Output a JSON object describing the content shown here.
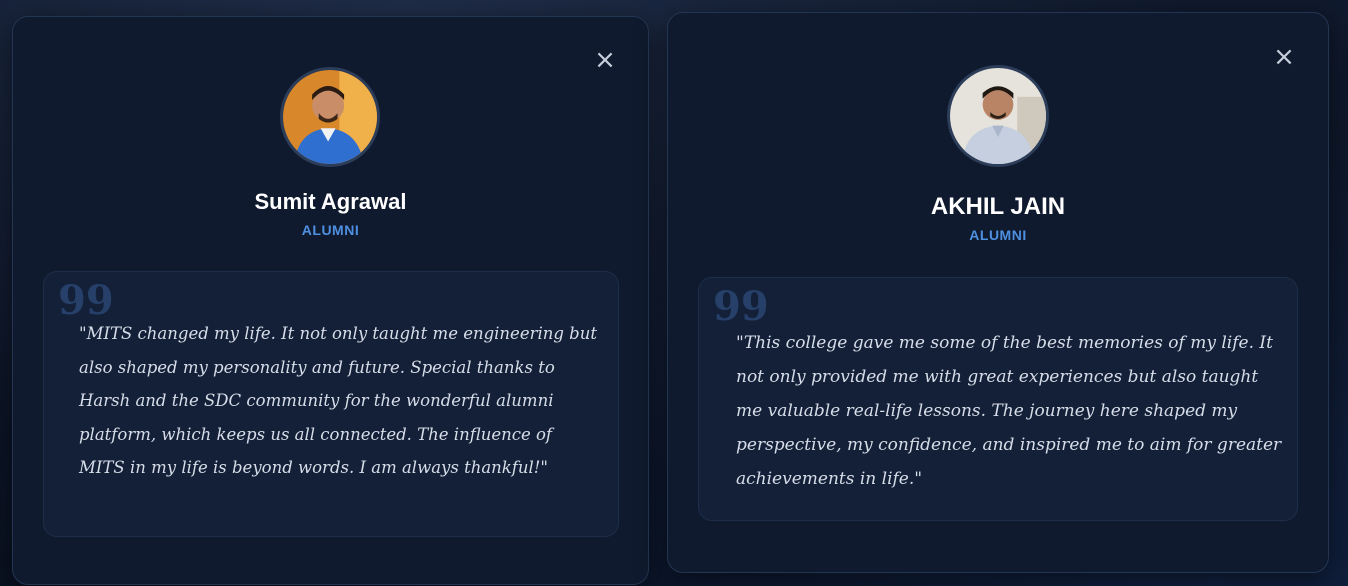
{
  "testimonials": [
    {
      "close_icon": "close-icon",
      "avatar": "avatar-sumit-agrawal",
      "name": "Sumit Agrawal",
      "role": "ALUMNI",
      "quote_icon": "quote-icon",
      "quote_mark": "99",
      "quote": "\"MITS changed my life. It not only taught me engineering but also shaped my personality and future. Special thanks to Harsh and the SDC community for the wonderful alumni platform, which keeps us all connected. The influence of MITS in my life is beyond words. I am always thankful!\""
    },
    {
      "close_icon": "close-icon",
      "avatar": "avatar-akhil-jain",
      "name": "AKHIL JAIN",
      "role": "ALUMNI",
      "quote_icon": "quote-icon",
      "quote_mark": "99",
      "quote": "\"This college gave me some of the best memories of my life. It not only provided me with great experiences but also taught me valuable real-life lessons. The journey here shaped my perspective, my confidence, and inspired me to aim for greater achievements in life.\""
    }
  ],
  "colors": {
    "background": "#0b1426",
    "card": "#0f1a2e",
    "accent": "#4f8fe0",
    "quote_box": "#132038"
  }
}
